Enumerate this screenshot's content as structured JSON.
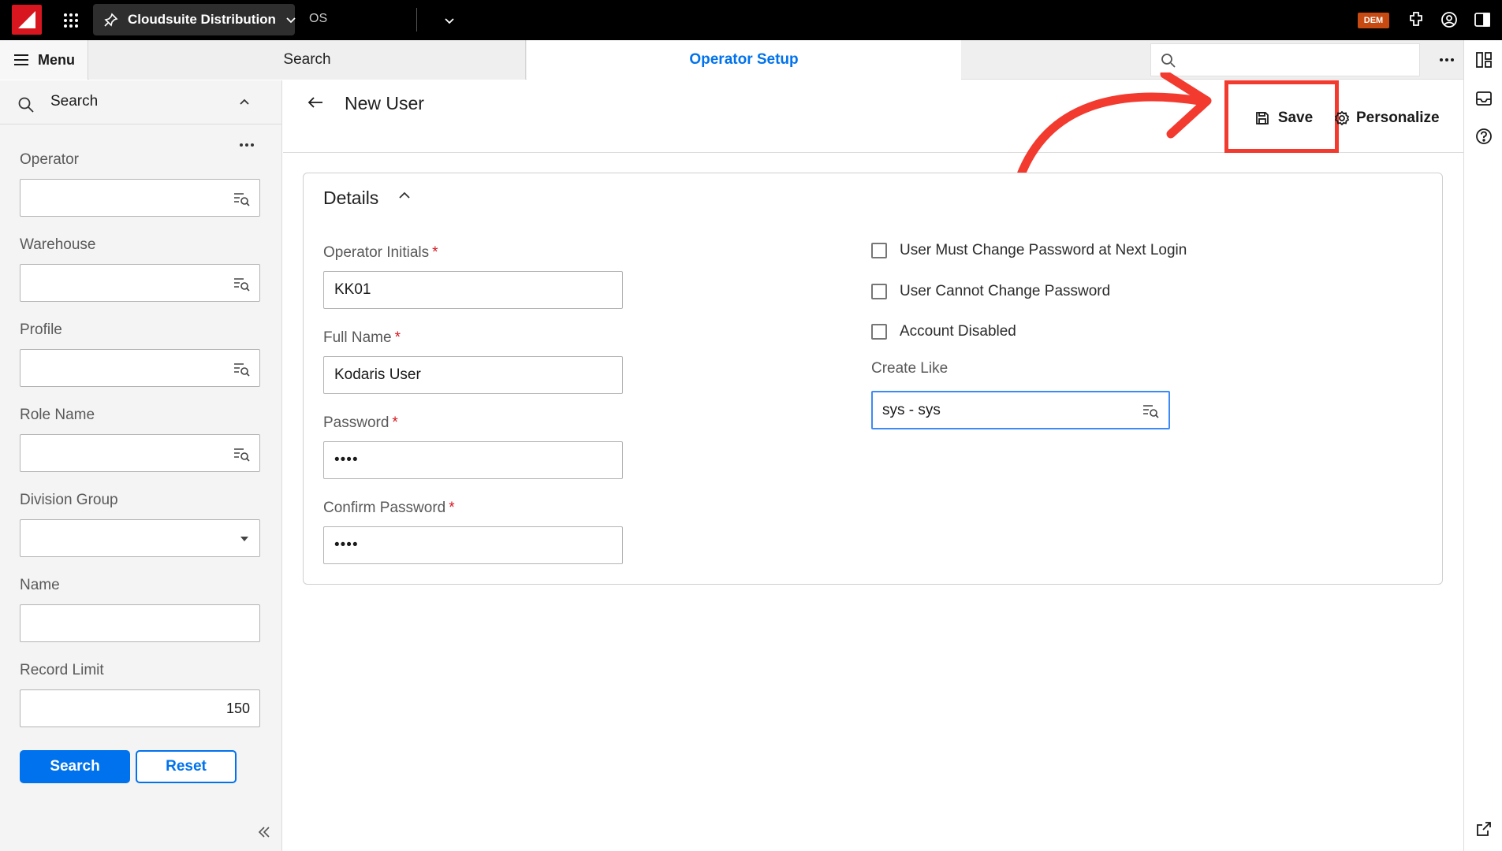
{
  "topbar": {
    "context_label": "Cloudsuite Distribution",
    "os_label": "OS",
    "badge": "DEM",
    "brand_color": "#d7161f"
  },
  "subbar": {
    "menu_label": "Menu",
    "tabs": [
      {
        "label": "Search",
        "active": false
      },
      {
        "label": "Operator Setup",
        "active": true
      }
    ],
    "search_placeholder": ""
  },
  "left_panel": {
    "title": "Search",
    "fields": [
      {
        "label": "Operator",
        "value": "",
        "type": "lookup"
      },
      {
        "label": "Warehouse",
        "value": "",
        "type": "lookup"
      },
      {
        "label": "Profile",
        "value": "",
        "type": "lookup"
      },
      {
        "label": "Role Name",
        "value": "",
        "type": "lookup"
      },
      {
        "label": "Division Group",
        "value": "",
        "type": "select"
      },
      {
        "label": "Name",
        "value": "",
        "type": "text"
      },
      {
        "label": "Record Limit",
        "value": "150",
        "type": "number"
      }
    ],
    "search_button": "Search",
    "reset_button": "Reset"
  },
  "main": {
    "title": "New User",
    "save_label": "Save",
    "personalize_label": "Personalize",
    "section_title": "Details",
    "fields": {
      "operator_initials": {
        "label": "Operator Initials",
        "value": "KK01",
        "required": "*"
      },
      "full_name": {
        "label": "Full Name",
        "value": "Kodaris User",
        "required": "*"
      },
      "password": {
        "label": "Password",
        "value": "••••",
        "required": "*"
      },
      "confirm_password": {
        "label": "Confirm Password",
        "value": "••••",
        "required": "*"
      }
    },
    "checkboxes": [
      {
        "label": "User Must Change Password at Next Login",
        "checked": false
      },
      {
        "label": "User Cannot Change Password",
        "checked": false
      },
      {
        "label": "Account Disabled",
        "checked": false
      }
    ],
    "create_like": {
      "label": "Create Like",
      "value": "sys - sys"
    }
  },
  "colors": {
    "accent": "#0072ed",
    "annotation": "#f23a2f",
    "badge": "#c64a12"
  },
  "icons": [
    "app-logo-icon",
    "app-grid-icon",
    "pin-icon",
    "chevron-down-icon",
    "plugin-icon",
    "user-icon",
    "sidebar-toggle-icon",
    "hamburger-icon",
    "search-icon",
    "more-icon",
    "lookup-icon",
    "back-arrow-icon",
    "save-icon",
    "personalize-icon",
    "chevron-up-icon",
    "double-chevron-left-icon",
    "layout-icon",
    "inbox-icon",
    "help-icon",
    "external-link-icon"
  ]
}
